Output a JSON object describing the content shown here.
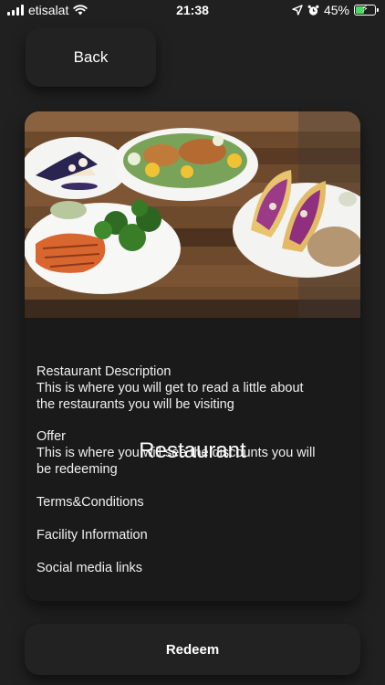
{
  "status_bar": {
    "carrier": "etisalat",
    "time": "21:38",
    "battery": "45%",
    "battery_level": 0.45,
    "icons": [
      "signal-icon",
      "wifi-icon",
      "location-arrow-icon",
      "alarm-icon",
      "battery-icon"
    ]
  },
  "back_button": {
    "label": "Back"
  },
  "restaurant": {
    "image_alt": "restaurant-food-photo",
    "title": "Restaurant",
    "description_heading": "Restaurant Description",
    "description_line1": "This is where you will get to read a little about",
    "description_line2": "the restaurants you will be visiting",
    "offer_heading": "Offer",
    "offer_line1": "This is where you will see the discounts you will",
    "offer_line2": "be redeeming",
    "terms": "Terms&Conditions",
    "facility": "Facility Information",
    "social": "Social media links"
  },
  "redeem_button": {
    "label": "Redeem"
  },
  "colors": {
    "background": "#202020",
    "surface": "#222222",
    "card": "#1a1a1a",
    "battery_green": "#4cd964"
  }
}
